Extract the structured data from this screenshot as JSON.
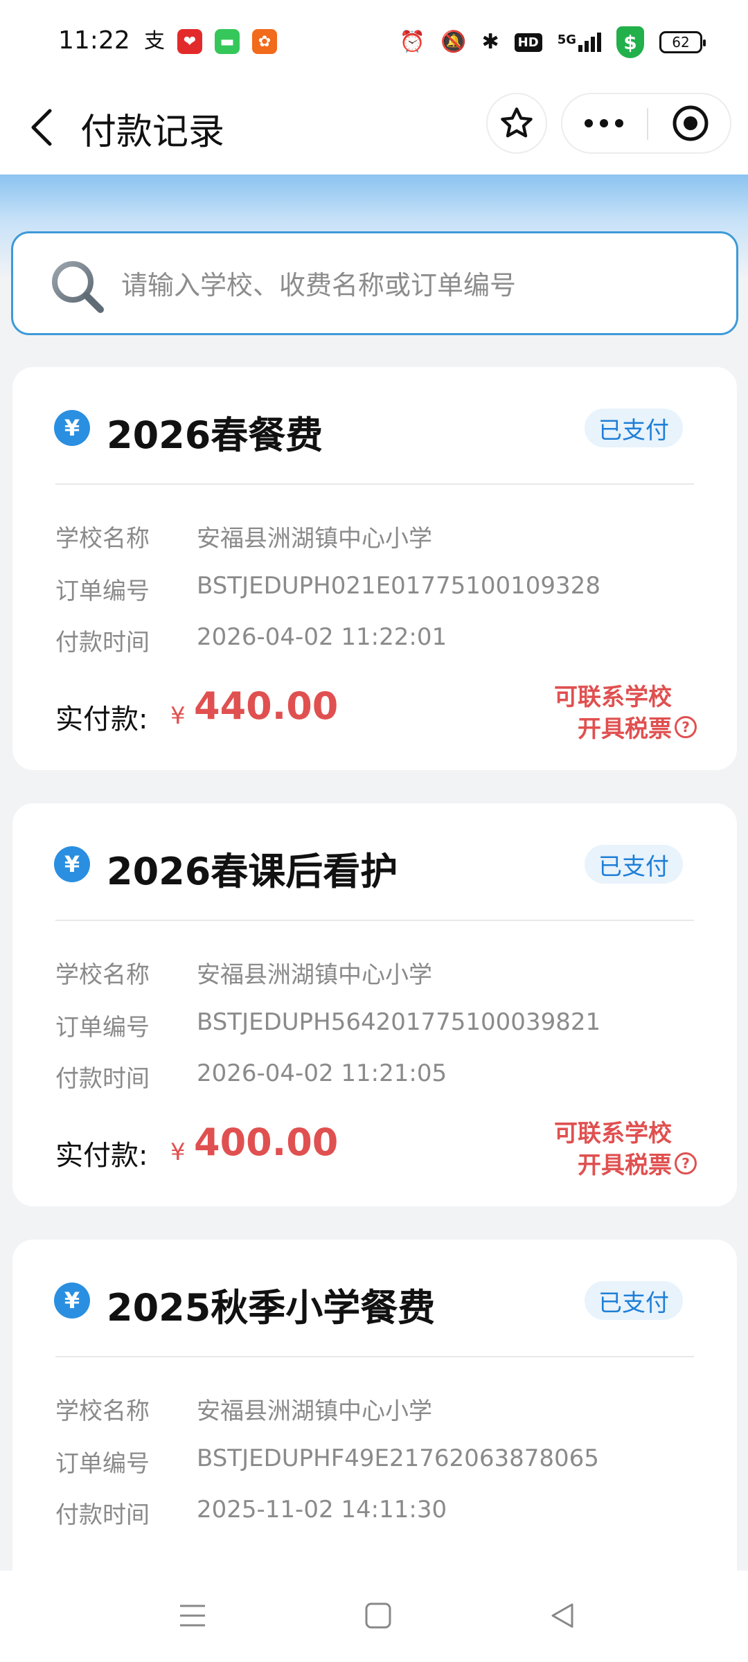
{
  "status_bar": {
    "time": "11:22",
    "left_icons": [
      "alipay-icon",
      "app-red-icon",
      "message-icon",
      "app-orange-icon"
    ],
    "right_icons": [
      "alarm-icon",
      "mute-icon",
      "bluetooth-icon",
      "hd-icon",
      "signal-5g-icon",
      "shield-icon",
      "battery-icon"
    ],
    "hd_label": "HD",
    "network_label": "5G",
    "battery": "62"
  },
  "header": {
    "title": "付款记录"
  },
  "search": {
    "placeholder": "请输入学校、收费名称或订单编号"
  },
  "labels": {
    "school": "学校名称",
    "order": "订单编号",
    "time": "付款时间",
    "paid": "实付款:",
    "currency": "¥",
    "tax_line1": "可联系学校",
    "tax_line2": "开具税票",
    "help_icon": "?"
  },
  "records": [
    {
      "title": "2026春餐费",
      "status": "已支付",
      "school": "安福县洲湖镇中心小学",
      "order_no": "BSTJEDUPH021E01775100109328",
      "pay_time": "2026-04-02 11:22:01",
      "amount": "440.00"
    },
    {
      "title": "2026春课后看护",
      "status": "已支付",
      "school": "安福县洲湖镇中心小学",
      "order_no": "BSTJEDUPH564201775100039821",
      "pay_time": "2026-04-02 11:21:05",
      "amount": "400.00"
    },
    {
      "title": "2025秋季小学餐费",
      "status": "已支付",
      "school": "安福县洲湖镇中心小学",
      "order_no": "BSTJEDUPHF49E21762063878065",
      "pay_time": "2025-11-02 14:11:30"
    }
  ],
  "colors": {
    "accent_blue": "#2a8fe0",
    "amount_red": "#e05050",
    "search_border": "#3c9ad8"
  }
}
